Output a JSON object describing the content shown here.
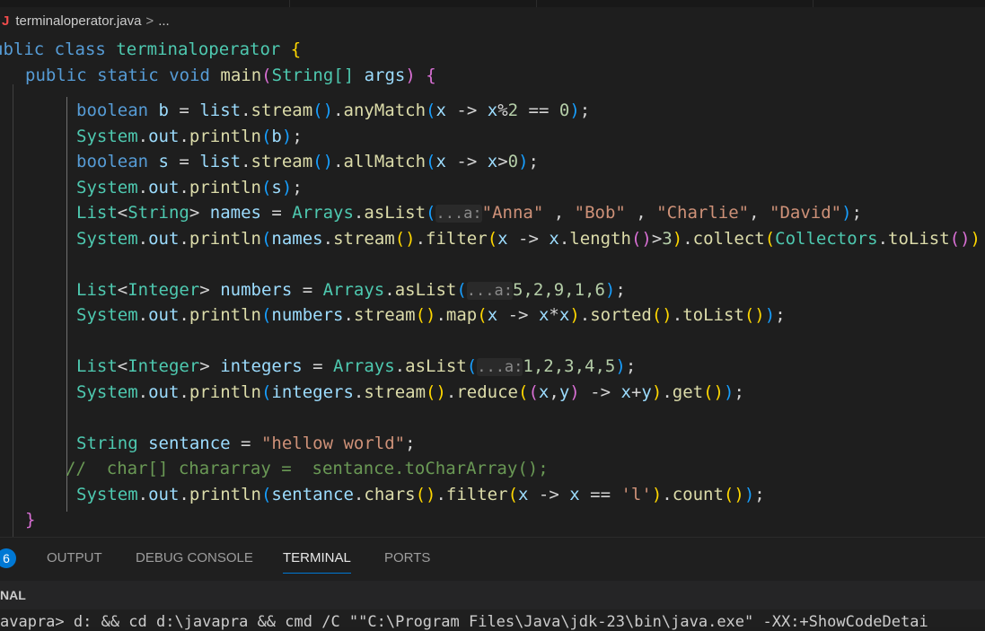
{
  "breadcrumb": {
    "icon_letter": "J",
    "file": "terminaloperator.java",
    "separator": ">",
    "more": "..."
  },
  "code": {
    "l1": {
      "kw": "ublic",
      "kw2": "class",
      "cls": "terminaloperator",
      "brace": "{"
    },
    "l2": {
      "public": "public",
      "static": "static",
      "void": "void",
      "name": "main",
      "type": "String[]",
      "arg": "args",
      "brace": "{"
    },
    "l3": {
      "type": "boolean",
      "var": "b",
      "list": "list",
      "stream": "stream",
      "fn": "anyMatch",
      "x": "x",
      "arrow": "->",
      "x2": "x",
      "num": "2",
      "num2": "0"
    },
    "l4": {
      "system": "System",
      "out": "out",
      "fn": "println",
      "arg": "b"
    },
    "l5": {
      "type": "boolean",
      "var": "s",
      "list": "list",
      "stream": "stream",
      "fn": "allMatch",
      "x": "x",
      "arrow": "->",
      "x2": "x",
      "num": "0"
    },
    "l6": {
      "system": "System",
      "out": "out",
      "fn": "println",
      "arg": "s"
    },
    "l7": {
      "type1": "List",
      "type2": "String",
      "var": "names",
      "cls": "Arrays",
      "fn": "asList",
      "hint": "...a:",
      "s1": "\"Anna\"",
      "s2": "\"Bob\"",
      "s3": "\"Charlie\"",
      "s4": "\"David\""
    },
    "l8": {
      "system": "System",
      "out": "out",
      "fn": "println",
      "var": "names",
      "stream": "stream",
      "filter": "filter",
      "x": "x",
      "arrow": "->",
      "x2": "x",
      "length": "length",
      "num": "3",
      "collect": "collect",
      "collectors": "Collectors",
      "toList": "toList"
    },
    "l9": {
      "type1": "List",
      "type2": "Integer",
      "var": "numbers",
      "cls": "Arrays",
      "fn": "asList",
      "hint": "...a:",
      "nums": "5,2,9,1,6"
    },
    "l10": {
      "system": "System",
      "out": "out",
      "fn": "println",
      "var": "numbers",
      "stream": "stream",
      "map": "map",
      "x": "x",
      "arrow": "->",
      "expr1": "x",
      "expr2": "x",
      "sorted": "sorted",
      "toList": "toList"
    },
    "l11": {
      "type1": "List",
      "type2": "Integer",
      "var": "integers",
      "cls": "Arrays",
      "fn": "asList",
      "hint": "...a:",
      "nums": "1,2,3,4,5"
    },
    "l12": {
      "system": "System",
      "out": "out",
      "fn": "println",
      "var": "integers",
      "stream": "stream",
      "reduce": "reduce",
      "x": "x",
      "y": "y",
      "arrow": "->",
      "ex": "x",
      "ey": "y",
      "get": "get"
    },
    "l13": {
      "type": "String",
      "var": "sentance",
      "str": "\"hellow world\""
    },
    "l14": {
      "comment": "//  char[] chararray =  sentance.toCharArray();"
    },
    "l15": {
      "system": "System",
      "out": "out",
      "fn": "println",
      "var": "sentance",
      "chars": "chars",
      "filter": "filter",
      "x": "x",
      "arrow": "->",
      "x2": "x",
      "ch": "'l'",
      "count": "count"
    },
    "l16": {
      "brace": "}"
    }
  },
  "panel": {
    "badge": "6",
    "tabs": [
      "OUTPUT",
      "DEBUG CONSOLE",
      "TERMINAL",
      "PORTS"
    ],
    "active_tab": "TERMINAL",
    "terminal_title": "NAL",
    "command_line": "avapra> d: && cd d:\\javapra && cmd /C \"\"C:\\Program Files\\Java\\jdk-23\\bin\\java.exe\" -XX:+ShowCodeDetai"
  },
  "colors": {
    "keyword": "#569cd6",
    "type": "#4ec9b0",
    "function": "#dcdcaa",
    "variable": "#9cdcfe",
    "string": "#ce9178",
    "number": "#b5cea8",
    "comment": "#6a9955",
    "accent": "#0078d4"
  }
}
